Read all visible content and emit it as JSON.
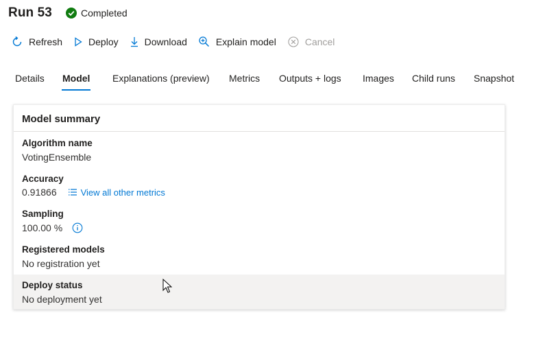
{
  "header": {
    "title": "Run 53",
    "status": "Completed",
    "status_color": "#107c10"
  },
  "toolbar": {
    "refresh": "Refresh",
    "deploy": "Deploy",
    "download": "Download",
    "explain": "Explain model",
    "cancel": "Cancel"
  },
  "tabs": [
    {
      "label": "Details"
    },
    {
      "label": "Model",
      "active": true
    },
    {
      "label": "Explanations (preview)"
    },
    {
      "label": "Metrics"
    },
    {
      "label": "Outputs + logs"
    },
    {
      "label": "Images"
    },
    {
      "label": "Child runs"
    },
    {
      "label": "Snapshot"
    }
  ],
  "summary": {
    "title": "Model summary",
    "algorithm_label": "Algorithm name",
    "algorithm_value": "VotingEnsemble",
    "accuracy_label": "Accuracy",
    "accuracy_value": "0.91866",
    "metrics_link": "View all other metrics",
    "sampling_label": "Sampling",
    "sampling_value": "100.00 %",
    "registered_label": "Registered models",
    "registered_value": "No registration yet",
    "deploy_label": "Deploy status",
    "deploy_value": "No deployment yet"
  },
  "colors": {
    "accent": "#0078d4"
  }
}
